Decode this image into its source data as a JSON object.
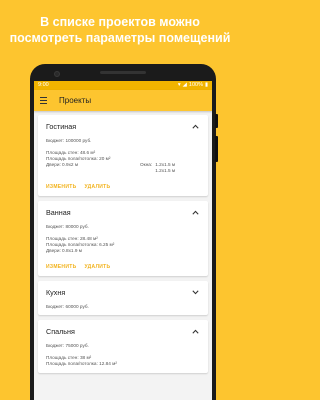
{
  "promo": {
    "line1": "В списке проектов можно",
    "line2": "посмотреть параметры помещений"
  },
  "statusbar": {
    "time": "9:00",
    "battery": "100%"
  },
  "appbar": {
    "title": "Проекты",
    "menu_icon": "menu-icon"
  },
  "colors": {
    "accent": "#FDC52F",
    "status": "#F1B400",
    "action": "#F2B21B"
  },
  "rooms": [
    {
      "name": "Гостиная",
      "budget": "Бюджет: 100000 руб.",
      "walls": "Площадь стен: 48.6 м²",
      "floor": "Площадь пола/потолка: 20 м²",
      "doors": "Двери: 0.9х2 м",
      "windows_label": "Окна:",
      "window1": "1.2х1.5 м",
      "window2": "1.2х1.5 м",
      "edit": "ИЗМЕНИТЬ",
      "delete": "УДАЛИТЬ"
    },
    {
      "name": "Ванная",
      "budget": "Бюджет: 80000 руб.",
      "walls": "Площадь стен: 28.48 м²",
      "floor": "Площадь пола/потолка: 6.25 м²",
      "doors": "Двери: 0.8х1.9 м",
      "edit": "ИЗМЕНИТЬ",
      "delete": "УДАЛИТЬ"
    },
    {
      "name": "Кухня",
      "budget": "Бюджет: 60000 руб."
    },
    {
      "name": "Спальня",
      "budget": "Бюджет: 75000 руб.",
      "walls": "Площадь стен: 38 м²",
      "floor": "Площадь пола/потолка: 12.84 м²"
    }
  ]
}
